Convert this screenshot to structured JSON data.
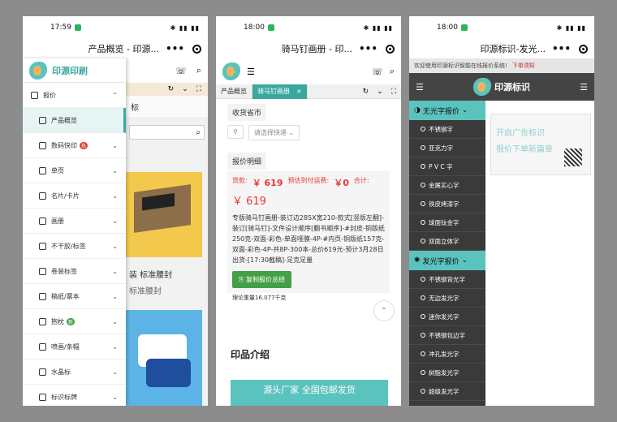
{
  "colors": {
    "accent": "#3aa89f",
    "price": "#e53935",
    "green": "#43a047"
  },
  "phone1": {
    "time": "17:59",
    "title": "产品概览 - 印源...",
    "brand": "印源印刷",
    "group": "报价",
    "items": [
      {
        "label": "产品概览",
        "active": true
      },
      {
        "label": "数码快印",
        "badge": "热"
      },
      {
        "label": "单页"
      },
      {
        "label": "名片/卡片"
      },
      {
        "label": "画册"
      },
      {
        "label": "不干胶/标签"
      },
      {
        "label": "卷装标签"
      },
      {
        "label": "稿纸/票本"
      },
      {
        "label": "抱枕",
        "badge": "新"
      },
      {
        "label": "喷画/条幅"
      },
      {
        "label": "水晶标"
      },
      {
        "label": "标识标牌"
      }
    ],
    "product_name": "装 标准腰封",
    "product_sub": "标准腰封"
  },
  "phone2": {
    "time": "18:00",
    "title": "骑马钉画册 - 印...",
    "tabs": [
      "产品概览",
      "骑马钉画册"
    ],
    "city_label": "收货省市",
    "express_placeholder": "请选择快递",
    "detail_label": "报价明细",
    "price_label": "货款:",
    "price_value": "￥ 619",
    "freight_label": "预估到付运费:",
    "freight_value": "￥0",
    "total_label": "合计:",
    "total_value": "￥ 619",
    "desc": "专版骑马钉画册-装订边285X宽210-款式[竖版左翻]-装订[骑马钉]-文件设计顺序[翻书顺序]-#封皮-铜版纸250克-双面-彩色-单面哑膜-4P-#内页-铜版纸157克-双面-彩色-4P-共8P-300本-总价619元-预计3月28日出货-[17:30截稿]-足克足量",
    "copy_button": "复制报价总结",
    "weight": "理论重量16.077千克",
    "intro_title": "印品介绍",
    "banner": "源头厂家 全国包邮发货"
  },
  "phone3": {
    "time": "18:00",
    "title": "印源标识-发光...",
    "notice": "欢迎使用印源标识智能在线报价系统!",
    "notice_link": "下单须知",
    "brand": "印源标识",
    "cat1": "无光字报价",
    "cat1_items": [
      "不锈钢字",
      "亚克力字",
      "P V C 字",
      "金属实心字",
      "铁皮烤漆字",
      "球面钛金字",
      "双面立体字"
    ],
    "cat2": "发光字报价",
    "cat2_items": [
      "不锈钢背光字",
      "无边发光字",
      "迷你发光字",
      "不锈钢包边字",
      "冲孔发光字",
      "树脂发光字",
      "超级发光字"
    ],
    "ad_line1": "开启广告标识",
    "ad_line2": "报价下单新篇章"
  }
}
